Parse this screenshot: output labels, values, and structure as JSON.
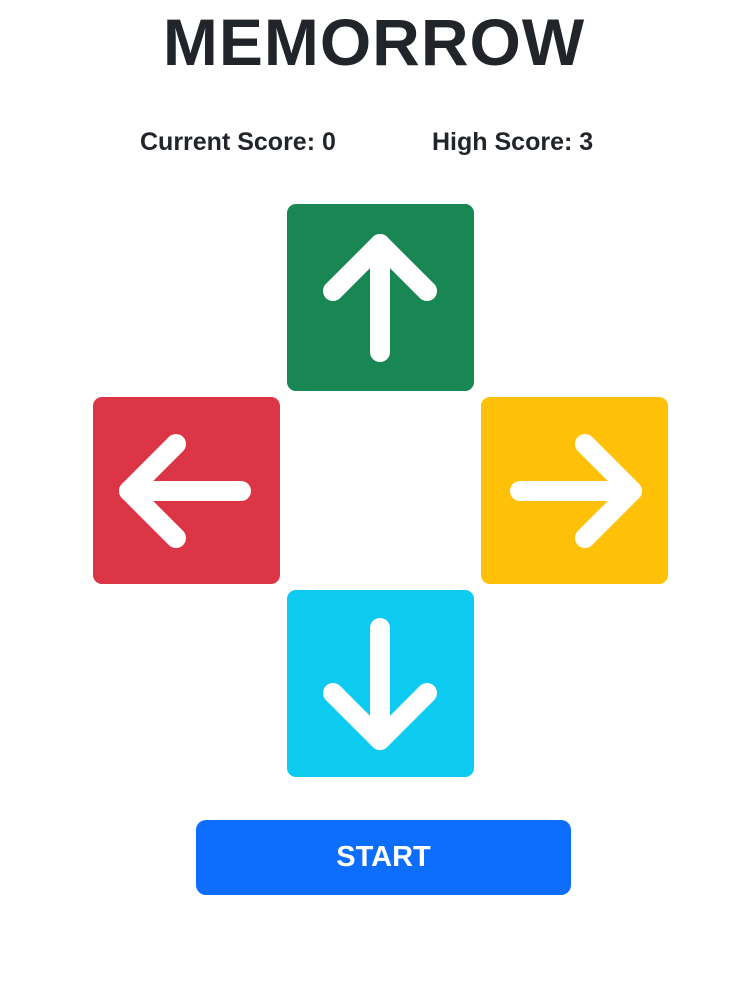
{
  "game": {
    "title": "MEMORROW"
  },
  "scores": {
    "current_label": "Current Score: 0",
    "current_value": 0,
    "high_label": "High Score: 3",
    "high_value": 3
  },
  "pads": [
    {
      "id": "up",
      "icon": "arrow-up-icon",
      "color": "#198754"
    },
    {
      "id": "left",
      "icon": "arrow-left-icon",
      "color": "#dc3545"
    },
    {
      "id": "right",
      "icon": "arrow-right-icon",
      "color": "#ffc107"
    },
    {
      "id": "down",
      "icon": "arrow-down-icon",
      "color": "#0dcaf0"
    }
  ],
  "controls": {
    "start_label": "START",
    "start_color": "#0d6efd"
  },
  "colors": {
    "text": "#212529",
    "arrow": "#ffffff",
    "background": "#ffffff"
  }
}
